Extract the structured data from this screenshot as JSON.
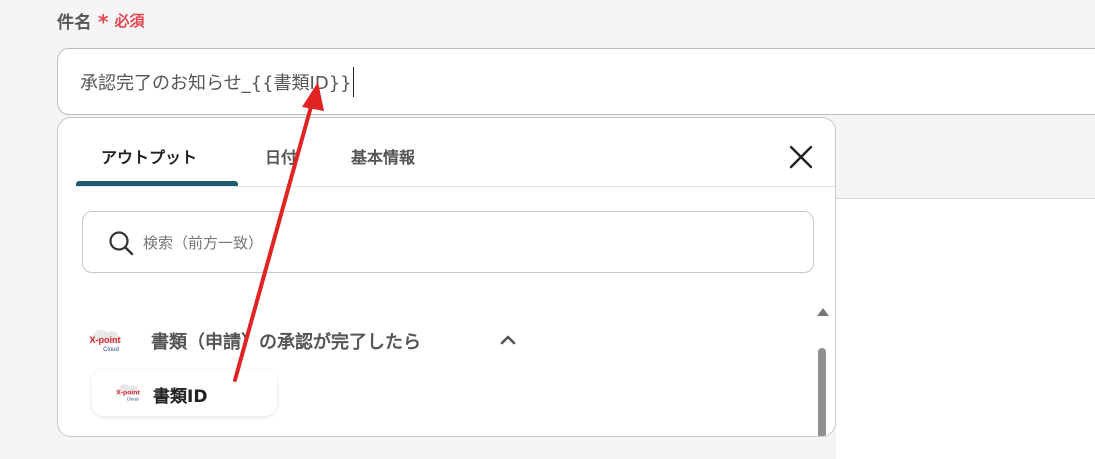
{
  "field": {
    "label": "件名",
    "required_mark": "*",
    "required_text": "必須",
    "value": "承認完了のお知らせ_{{書類ID}}"
  },
  "picker": {
    "tabs": [
      {
        "label": "アウトプット",
        "active": true
      },
      {
        "label": "日付",
        "active": false
      },
      {
        "label": "基本情報",
        "active": false
      }
    ],
    "search_placeholder": "検索（前方一致）",
    "section": {
      "title": "書類（申請）の承認が完了したら",
      "logo_text": "X-point",
      "logo_sub": "Cloud",
      "items": [
        {
          "label": "書類ID"
        }
      ]
    }
  },
  "colors": {
    "accent": "#1c5d72",
    "required": "#e2474f",
    "arrow": "#e02424"
  },
  "icons": [
    "close-icon",
    "search-icon",
    "chevron-up-icon",
    "xpoint-logo"
  ]
}
